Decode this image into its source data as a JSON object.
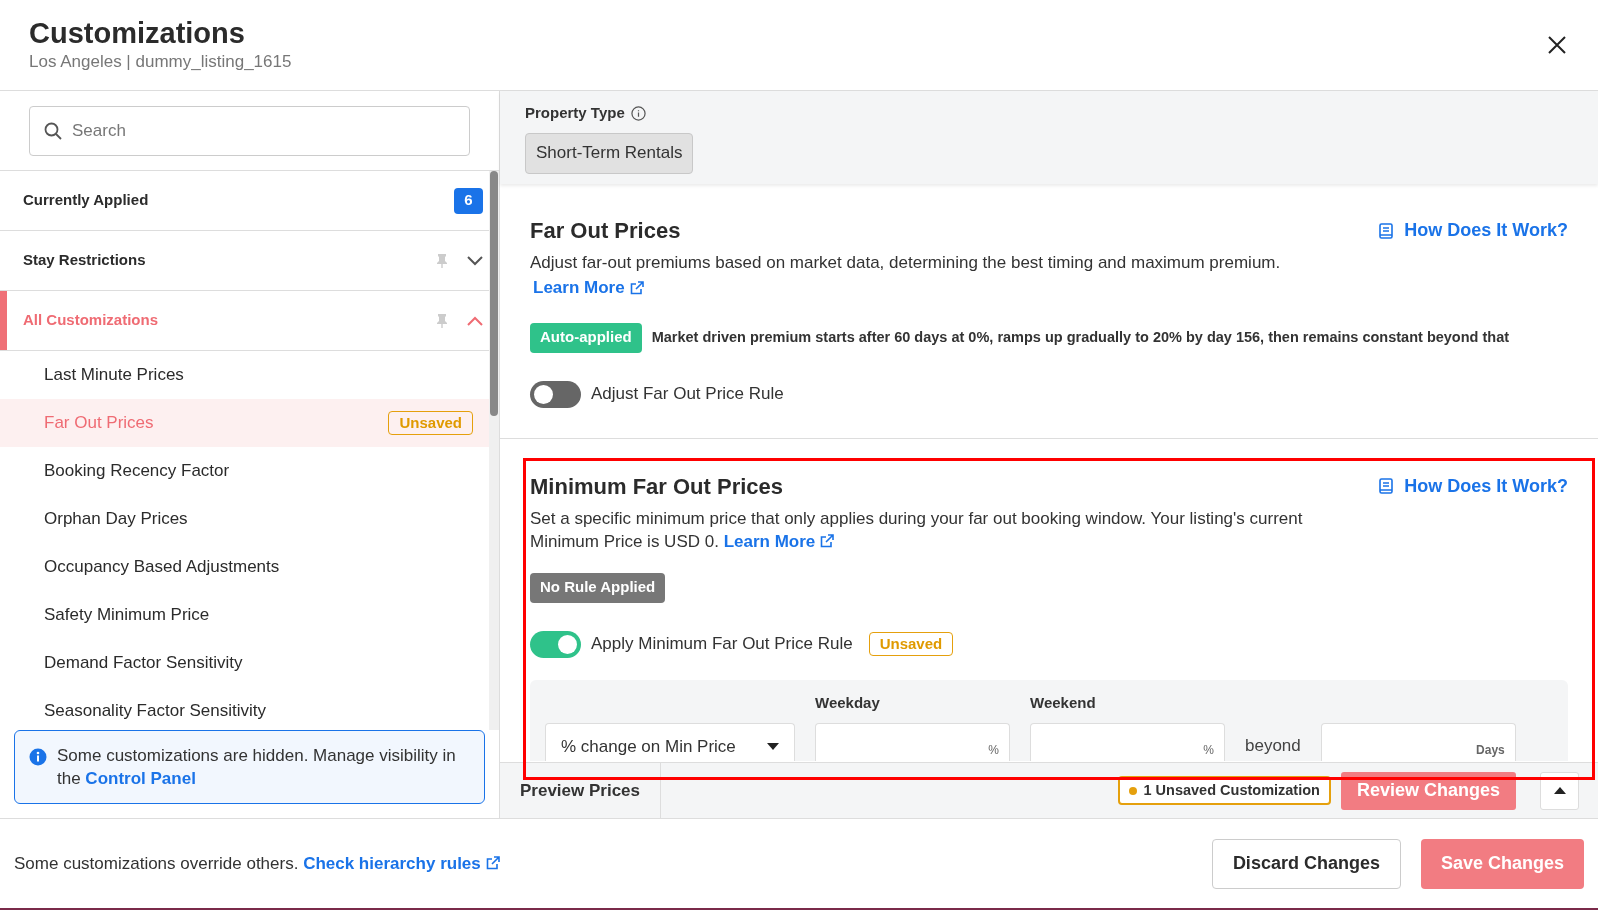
{
  "header": {
    "title": "Customizations",
    "subtitle": "Los Angeles | dummy_listing_1615"
  },
  "sidebar": {
    "search": {
      "placeholder": "Search"
    },
    "groups": [
      {
        "label": "Currently Applied",
        "kind": "count",
        "count": "6",
        "selected": false
      },
      {
        "label": "Stay Restrictions",
        "kind": "folder",
        "selected": false,
        "expanded": false
      },
      {
        "label": "All Customizations",
        "kind": "folder",
        "selected": true,
        "expanded": true,
        "children": [
          {
            "label": "Last Minute Prices",
            "selected": false
          },
          {
            "label": "Far Out Prices",
            "selected": true,
            "badge": "Unsaved"
          },
          {
            "label": "Booking Recency Factor",
            "selected": false
          },
          {
            "label": "Orphan Day Prices",
            "selected": false
          },
          {
            "label": "Occupancy Based Adjustments",
            "selected": false
          },
          {
            "label": "Safety Minimum Price",
            "selected": false
          },
          {
            "label": "Demand Factor Sensitivity",
            "selected": false
          },
          {
            "label": "Seasonality Factor Sensitivity",
            "selected": false
          }
        ]
      }
    ],
    "notice": {
      "text": "Some customizations are hidden. Manage visibility in the",
      "link": "Control Panel"
    }
  },
  "property_type": {
    "label": "Property Type",
    "value": "Short-Term Rentals"
  },
  "sections": [
    {
      "title": "Far Out Prices",
      "help_link": "How Does It Work?",
      "description": "Adjust far-out premiums based on market data, determining the best timing and maximum premium.",
      "learn_more": "Learn More",
      "link_inline": false,
      "highlighted": false,
      "status": {
        "kind": "auto",
        "text": "Auto-applied"
      },
      "summary": "Market driven premium starts after 60 days at 0%, ramps up gradually to 20% by day 156, then remains constant beyond that",
      "toggle": {
        "label": "Adjust Far Out Price Rule",
        "on": false
      }
    },
    {
      "title": "Minimum Far Out Prices",
      "help_link": "How Does It Work?",
      "description": "Set a specific minimum price that only applies during your far out booking window. Your listing's current Minimum Price is USD 0.",
      "learn_more": "Learn More",
      "link_inline": true,
      "highlighted": true,
      "status": {
        "kind": "none",
        "text": "No Rule Applied"
      },
      "toggle": {
        "label": "Apply Minimum Far Out Price Rule",
        "on": true,
        "badge": "Unsaved"
      },
      "form": {
        "select": "% change on Min Price",
        "weekday": {
          "label": "Weekday",
          "unit": "%"
        },
        "weekend": {
          "label": "Weekend",
          "unit": "%"
        },
        "beyond": "beyond",
        "days_unit": "Days"
      }
    }
  ],
  "preview_bar": {
    "label": "Preview Prices",
    "unsaved": "1 Unsaved Customization",
    "review": "Review Changes"
  },
  "footer": {
    "note": "Some customizations override others.",
    "link": "Check hierarchy rules",
    "buttons": [
      {
        "label": "Discard Changes",
        "kind": "secondary"
      },
      {
        "label": "Save Changes",
        "kind": "primary"
      }
    ]
  }
}
